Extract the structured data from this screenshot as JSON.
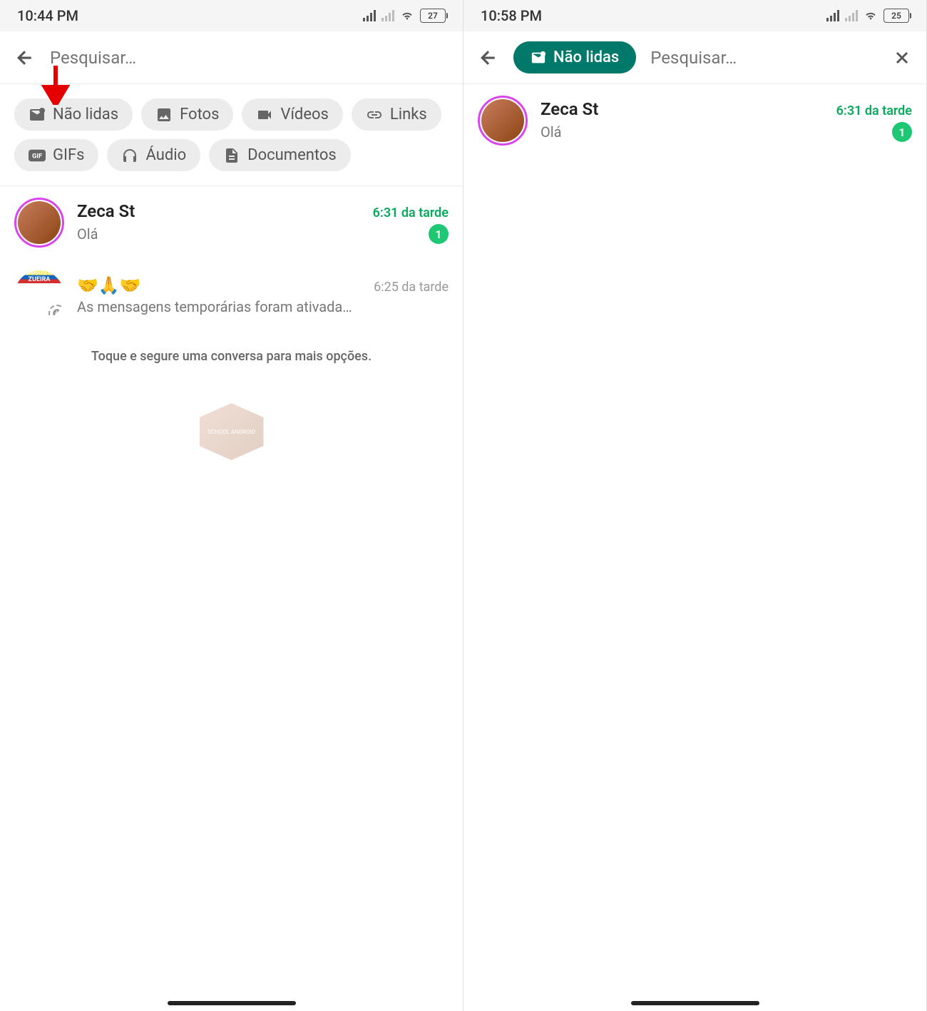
{
  "left": {
    "status": {
      "time": "10:44 PM",
      "battery": "27"
    },
    "search": {
      "placeholder": "Pesquisar…"
    },
    "chips": [
      {
        "icon": "unread",
        "label": "Não lidas"
      },
      {
        "icon": "photo",
        "label": "Fotos"
      },
      {
        "icon": "video",
        "label": "Vídeos"
      },
      {
        "icon": "link",
        "label": "Links"
      },
      {
        "icon": "gif",
        "label": "GIFs"
      },
      {
        "icon": "audio",
        "label": "Áudio"
      },
      {
        "icon": "doc",
        "label": "Documentos"
      }
    ],
    "chats": [
      {
        "name": "Zeca St",
        "msg": "Olá",
        "time": "6:31 da tarde",
        "unread": "1"
      },
      {
        "name": "🤝🙏🤝",
        "msg": "As mensagens temporárias foram ativada…",
        "time": "6:25 da tarde"
      }
    ],
    "hint": "Toque e segure uma conversa para mais opções."
  },
  "right": {
    "status": {
      "time": "10:58 PM",
      "battery": "25"
    },
    "search": {
      "placeholder": "Pesquisar…"
    },
    "active_filter": "Não lidas",
    "chats": [
      {
        "name": "Zeca St",
        "msg": "Olá",
        "time": "6:31 da tarde",
        "unread": "1"
      }
    ]
  },
  "avatar_zueira_text": "AMIGOS DE ZUEIRA"
}
